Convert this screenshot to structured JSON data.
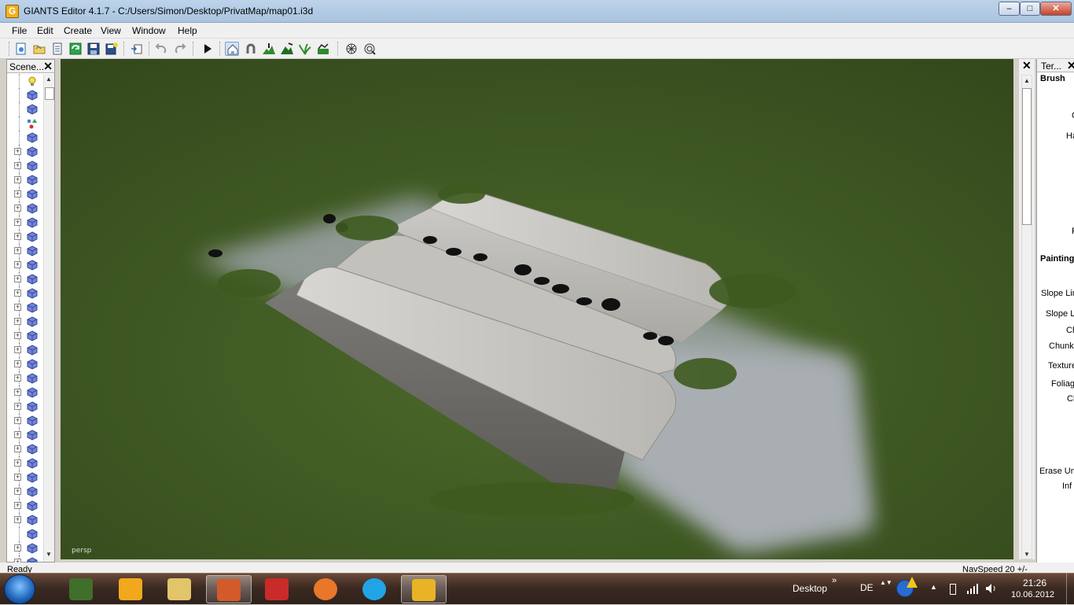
{
  "window": {
    "title": "GIANTS Editor 4.1.7 - C:/Users/Simon/Desktop/PrivatMap/map01.i3d",
    "app_icon_letter": "G",
    "buttons": {
      "minimize": "–",
      "maximize": "□",
      "close": "✕"
    }
  },
  "menu": [
    "File",
    "Edit",
    "Create",
    "View",
    "Window",
    "Help"
  ],
  "toolbar": {
    "icons": [
      "new-scene-icon",
      "open-folder-icon",
      "open-file-icon",
      "reload-icon",
      "save-icon",
      "save-as-icon",
      "import-icon",
      "undo-icon",
      "redo-icon",
      "play-icon",
      "home-tool-icon",
      "magnet-tool-icon",
      "terrain-sculpt-icon",
      "terrain-paint-icon",
      "foliage-paint-icon",
      "terrain-smooth-icon",
      "grid-toggle-icon",
      "wireframe-toggle-icon"
    ]
  },
  "scenegraph": {
    "title": "Scene...",
    "close": "✕",
    "rows": [
      {
        "icon": "light-icon",
        "expand": false
      },
      {
        "icon": "cube-icon",
        "expand": false
      },
      {
        "icon": "cube-icon",
        "expand": false
      },
      {
        "icon": "shapes-icon",
        "expand": false
      },
      {
        "icon": "cube-icon",
        "expand": false
      },
      {
        "icon": "cube-icon",
        "expand": true
      },
      {
        "icon": "cube-icon",
        "expand": true
      },
      {
        "icon": "cube-icon",
        "expand": true
      },
      {
        "icon": "cube-icon",
        "expand": true
      },
      {
        "icon": "cube-icon",
        "expand": true
      },
      {
        "icon": "cube-icon",
        "expand": true
      },
      {
        "icon": "cube-icon",
        "expand": true
      },
      {
        "icon": "cube-icon",
        "expand": true
      },
      {
        "icon": "cube-icon",
        "expand": true
      },
      {
        "icon": "cube-icon",
        "expand": true
      },
      {
        "icon": "cube-icon",
        "expand": true
      },
      {
        "icon": "cube-icon",
        "expand": true
      },
      {
        "icon": "cube-icon",
        "expand": true
      },
      {
        "icon": "cube-icon",
        "expand": true
      },
      {
        "icon": "cube-icon",
        "expand": true
      },
      {
        "icon": "cube-icon",
        "expand": true
      },
      {
        "icon": "cube-icon",
        "expand": true
      },
      {
        "icon": "cube-icon",
        "expand": true
      },
      {
        "icon": "cube-icon",
        "expand": true
      },
      {
        "icon": "cube-icon",
        "expand": true
      },
      {
        "icon": "cube-icon",
        "expand": true
      },
      {
        "icon": "cube-icon",
        "expand": true
      },
      {
        "icon": "cube-icon",
        "expand": true
      },
      {
        "icon": "cube-icon",
        "expand": true
      },
      {
        "icon": "cube-icon",
        "expand": true
      },
      {
        "icon": "cube-icon",
        "expand": true
      },
      {
        "icon": "cube-icon",
        "expand": true
      },
      {
        "icon": "cube-icon",
        "expand": false
      },
      {
        "icon": "cube-icon",
        "expand": true
      },
      {
        "icon": "cube-icon",
        "expand": true
      },
      {
        "icon": "cube-icon",
        "expand": true
      },
      {
        "icon": "cube-icon",
        "expand": true
      }
    ]
  },
  "viewport": {
    "camera_label": "persp"
  },
  "terrain_panel": {
    "title": "Ter...",
    "close": "✕",
    "labels": [
      {
        "text": "Brush",
        "bold": true
      },
      {
        "text": "C",
        "bold": false
      },
      {
        "text": "Ha",
        "bold": false
      },
      {
        "text": "F",
        "bold": false
      },
      {
        "text": "Painting",
        "bold": true
      },
      {
        "text": "Slope Lim",
        "bold": false
      },
      {
        "text": "Slope Li",
        "bold": false
      },
      {
        "text": "Ch",
        "bold": false
      },
      {
        "text": "Chunk",
        "bold": false
      },
      {
        "text": "Texture",
        "bold": false
      },
      {
        "text": "Foliage",
        "bold": false
      },
      {
        "text": "Ch",
        "bold": false
      },
      {
        "text": "Erase Unu",
        "bold": false
      },
      {
        "text": "Inf",
        "bold": false
      }
    ]
  },
  "status": {
    "text": "Ready",
    "nav_speed": "NavSpeed 20 +/-"
  },
  "taskbar": {
    "apps": [
      {
        "name": "tractor-app-icon",
        "active": false
      },
      {
        "name": "hardhat-app-icon",
        "active": false
      },
      {
        "name": "explorer-app-icon",
        "active": false
      },
      {
        "name": "media-app-icon",
        "active": true
      },
      {
        "name": "mpeg-app-icon",
        "active": false
      },
      {
        "name": "firefox-app-icon",
        "active": false
      },
      {
        "name": "skype-app-icon",
        "active": false
      },
      {
        "name": "giants-editor-app-icon",
        "active": true
      }
    ],
    "desktop_label": "Desktop",
    "desktop_chevron": "»",
    "language": "DE",
    "time": "21:26",
    "date": "10.06.2012"
  }
}
